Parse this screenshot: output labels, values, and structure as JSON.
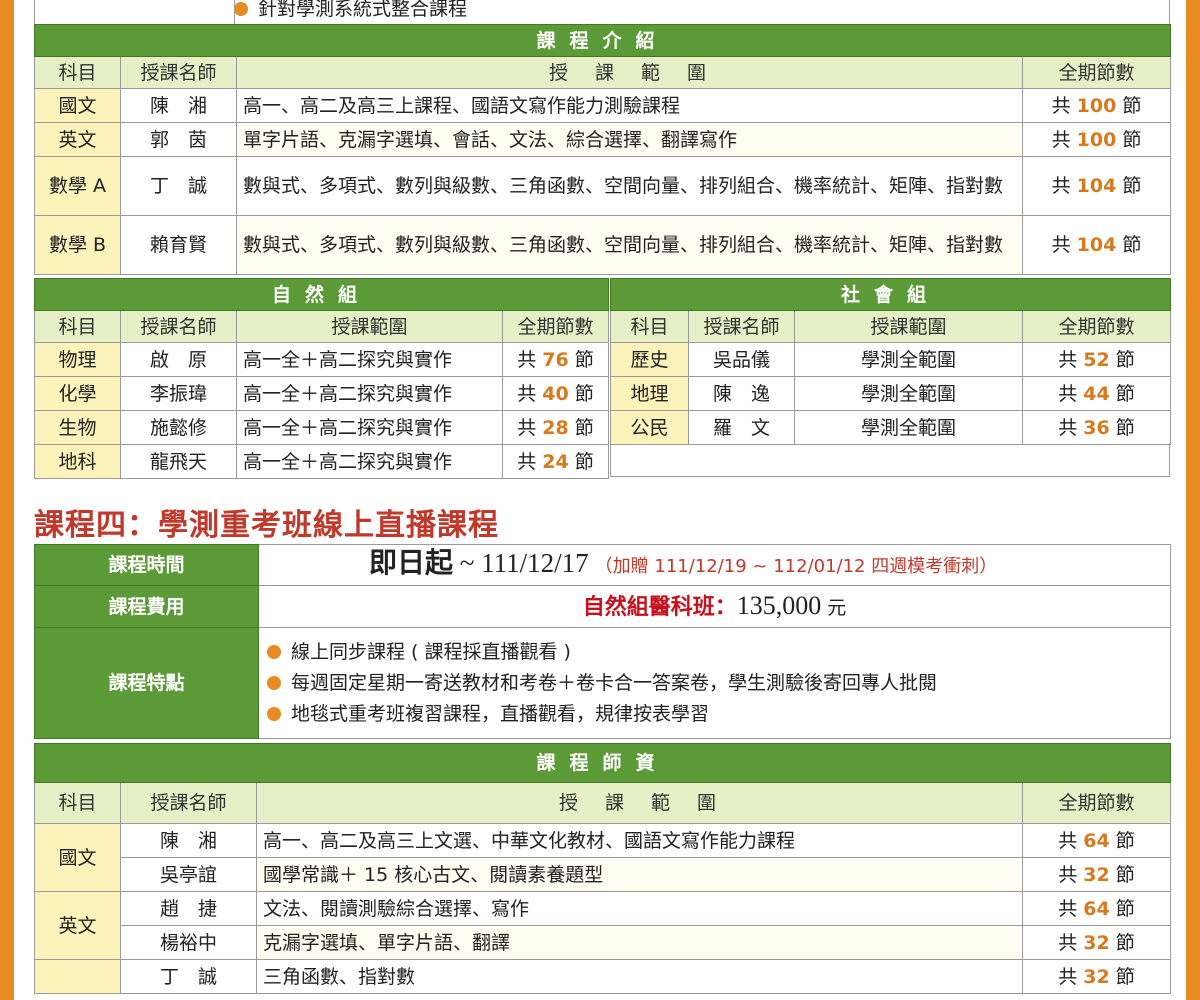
{
  "top_partial": {
    "bullet_text": "針對學測系統式整合課程"
  },
  "course_intro": {
    "header": "課程介紹",
    "columns": [
      "科目",
      "授課名師",
      "授　課　範　圍",
      "全期節數"
    ],
    "rows": [
      {
        "subject": "國文",
        "teacher": "陳　湘",
        "range": "高一、高二及高三上課程、國語文寫作能力測驗課程",
        "pre": "共",
        "count": "100",
        "post": "節"
      },
      {
        "subject": "英文",
        "teacher": "郭　茵",
        "range": "單字片語、克漏字選填、會話、文法、綜合選擇、翻譯寫作",
        "pre": "共",
        "count": "100",
        "post": "節"
      },
      {
        "subject": "數學 A",
        "teacher": "丁　誠",
        "range": "數與式、多項式、數列與級數、三角函數、空間向量、排列組合、機率統計、矩陣、指對數",
        "pre": "共",
        "count": "104",
        "post": "節"
      },
      {
        "subject": "數學 B",
        "teacher": "賴育賢",
        "range": "數與式、多項式、數列與級數、三角函數、空間向量、排列組合、機率統計、矩陣、指對數",
        "pre": "共",
        "count": "104",
        "post": "節"
      }
    ]
  },
  "natural_group": {
    "header": "自然組",
    "columns": [
      "科目",
      "授課名師",
      "授課範圍",
      "全期節數"
    ],
    "rows": [
      {
        "subject": "物理",
        "teacher": "啟　原",
        "range": "高一全＋高二探究與實作",
        "pre": "共",
        "count": "76",
        "post": "節"
      },
      {
        "subject": "化學",
        "teacher": "李振瑋",
        "range": "高一全＋高二探究與實作",
        "pre": "共",
        "count": "40",
        "post": "節"
      },
      {
        "subject": "生物",
        "teacher": "施懿修",
        "range": "高一全＋高二探究與實作",
        "pre": "共",
        "count": "28",
        "post": "節"
      },
      {
        "subject": "地科",
        "teacher": "龍飛天",
        "range": "高一全＋高二探究與實作",
        "pre": "共",
        "count": "24",
        "post": "節"
      }
    ]
  },
  "social_group": {
    "header": "社會組",
    "columns": [
      "科目",
      "授課名師",
      "授課範圍",
      "全期節數"
    ],
    "rows": [
      {
        "subject": "歷史",
        "teacher": "吳品儀",
        "range": "學測全範圍",
        "pre": "共",
        "count": "52",
        "post": "節"
      },
      {
        "subject": "地理",
        "teacher": "陳　逸",
        "range": "學測全範圍",
        "pre": "共",
        "count": "44",
        "post": "節"
      },
      {
        "subject": "公民",
        "teacher": "羅　文",
        "range": "學測全範圍",
        "pre": "共",
        "count": "36",
        "post": "節"
      }
    ]
  },
  "course4": {
    "title": "課程四：學測重考班線上直播課程",
    "time_label": "課程時間",
    "time_start": "即日起",
    "time_end": " ~ 111/12/17",
    "time_note": "（加贈 111/12/19 ~ 112/01/12 四週模考衝刺）",
    "fee_label": "課程費用",
    "fee_class": "自然組醫科班：",
    "fee_amount": "135,000",
    "fee_unit": "元",
    "feature_label": "課程特點",
    "features": [
      "線上同步課程 ( 課程採直播觀看 )",
      "每週固定星期一寄送教材和考卷＋卷卡合一答案卷，學生測驗後寄回專人批閱",
      "地毯式重考班複習課程，直播觀看，規律按表學習"
    ]
  },
  "faculty": {
    "header": "課程師資",
    "columns": [
      "科目",
      "授課名師",
      "授　課　範　圍",
      "全期節數"
    ],
    "rows": [
      {
        "subject": "國文",
        "teacher": "陳　湘",
        "range": "高一、高二及高三上文選、中華文化教材、國語文寫作能力課程",
        "pre": "共",
        "count": "64",
        "post": "節"
      },
      {
        "subject": "",
        "teacher": "吳亭誼",
        "range": "國學常識＋ 15 核心古文、閱讀素養題型",
        "pre": "共",
        "count": "32",
        "post": "節"
      },
      {
        "subject": "英文",
        "teacher": "趙　捷",
        "range": "文法、閱讀測驗綜合選擇、寫作",
        "pre": "共",
        "count": "64",
        "post": "節"
      },
      {
        "subject": "",
        "teacher": "楊裕中",
        "range": "克漏字選填、單字片語、翻譯",
        "pre": "共",
        "count": "32",
        "post": "節"
      },
      {
        "subject": "",
        "teacher": "丁　誠",
        "range": "三角函數、指對數",
        "pre": "共",
        "count": "32",
        "post": "節"
      }
    ]
  }
}
